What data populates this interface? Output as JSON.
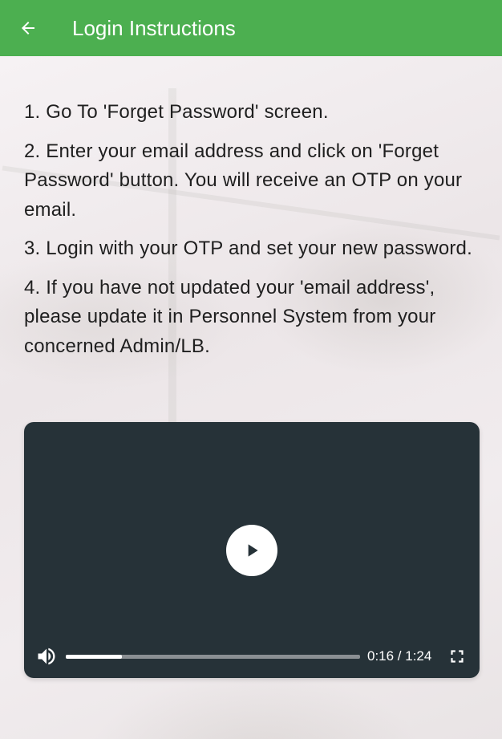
{
  "app_bar": {
    "title": "Login Instructions",
    "back_icon": "arrow-back-icon",
    "color": "#4caf50"
  },
  "instructions": [
    "1. Go To 'Forget Password' screen.",
    "2. Enter your email address and click on 'Forget Password' button. You will receive an OTP on your email.",
    "3. Login with your OTP and set your new password.",
    "4. If you have not updated your 'email address', please update it in Personnel System from your concerned Admin/LB."
  ],
  "video_player": {
    "background_color": "#263238",
    "play_icon": "play-icon",
    "volume_icon": "volume-icon",
    "fullscreen_icon": "fullscreen-icon",
    "time_display": "0:16 / 1:24",
    "progress_fraction": 0.19
  }
}
